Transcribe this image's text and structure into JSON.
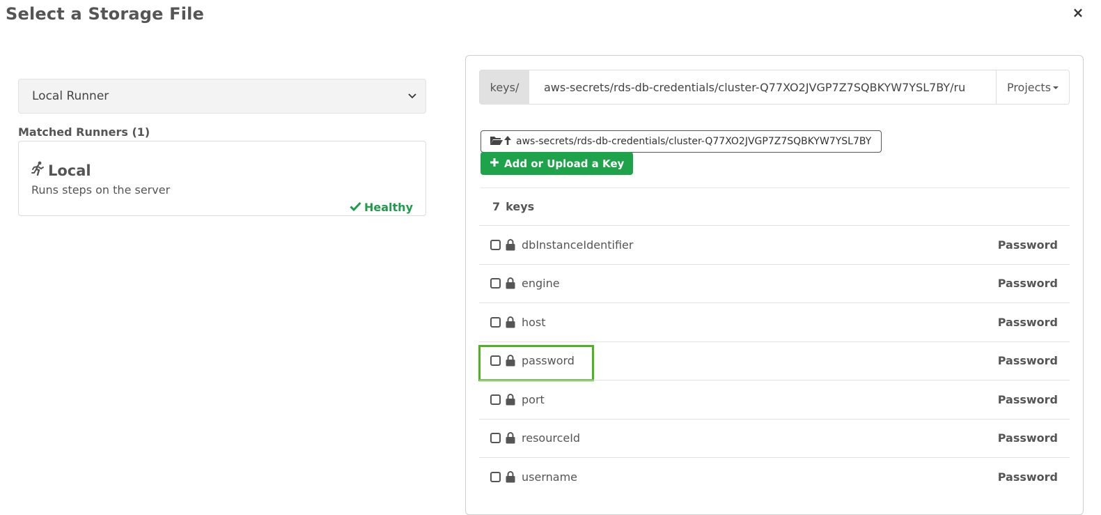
{
  "modal": {
    "title": "Select a Storage File",
    "close_label": "×"
  },
  "runner": {
    "selected": "Local Runner",
    "matched_label": "Matched Runners (1)",
    "card": {
      "name": "Local",
      "description": "Runs steps on the server",
      "status": "Healthy",
      "status_color": "#1e9c4c",
      "icon": "running-person-icon"
    }
  },
  "storage": {
    "prefix": "keys/",
    "path_value": "aws-secrets/rds-db-credentials/cluster-Q77XO2JVGP7Z7SQBKYW7YSL7BY/ru",
    "projects_label": "Projects",
    "up_dir_label": "aws-secrets/rds-db-credentials/cluster-Q77XO2JVGP7Z7SQBKYW7YSL7BY",
    "add_key_label": "Add or Upload a Key",
    "add_key_color": "#1fa34a",
    "count_number": "7",
    "count_label": "keys",
    "keys": [
      {
        "name": "dbInstanceIdentifier",
        "type": "Password"
      },
      {
        "name": "engine",
        "type": "Password"
      },
      {
        "name": "host",
        "type": "Password"
      },
      {
        "name": "password",
        "type": "Password",
        "highlighted": true
      },
      {
        "name": "port",
        "type": "Password"
      },
      {
        "name": "resourceId",
        "type": "Password"
      },
      {
        "name": "username",
        "type": "Password"
      }
    ],
    "highlight_color": "#4ab51e"
  }
}
